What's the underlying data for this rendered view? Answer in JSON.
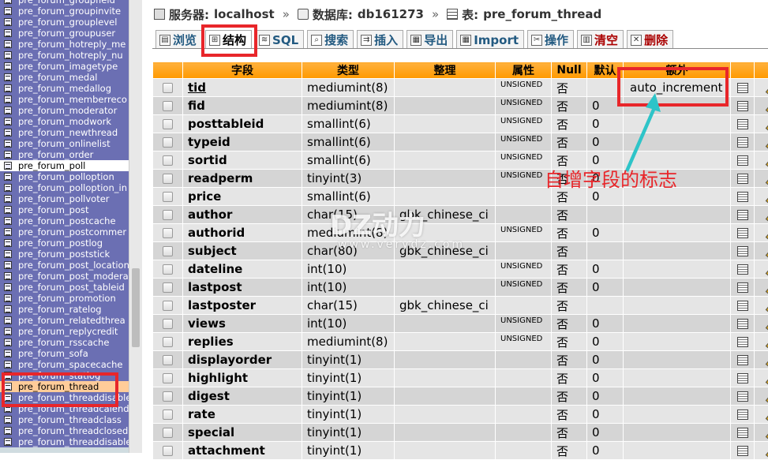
{
  "sidebar": {
    "items": [
      {
        "label": "pre_forum_groupfield",
        "state": "normal"
      },
      {
        "label": "pre_forum_groupinvite",
        "state": "normal"
      },
      {
        "label": "pre_forum_grouplevel",
        "state": "normal"
      },
      {
        "label": "pre_forum_groupuser",
        "state": "normal"
      },
      {
        "label": "pre_forum_hotreply_me",
        "state": "normal"
      },
      {
        "label": "pre_forum_hotreply_nu",
        "state": "normal"
      },
      {
        "label": "pre_forum_imagetype",
        "state": "normal"
      },
      {
        "label": "pre_forum_medal",
        "state": "normal"
      },
      {
        "label": "pre_forum_medallog",
        "state": "normal"
      },
      {
        "label": "pre_forum_memberreco",
        "state": "normal"
      },
      {
        "label": "pre_forum_moderator",
        "state": "normal"
      },
      {
        "label": "pre_forum_modwork",
        "state": "normal"
      },
      {
        "label": "pre_forum_newthread",
        "state": "normal"
      },
      {
        "label": "pre_forum_onlinelist",
        "state": "normal"
      },
      {
        "label": "pre_forum_order",
        "state": "normal"
      },
      {
        "label": "pre_forum_poll",
        "state": "plain"
      },
      {
        "label": "pre_forum_polloption",
        "state": "normal"
      },
      {
        "label": "pre_forum_polloption_in",
        "state": "normal"
      },
      {
        "label": "pre_forum_pollvoter",
        "state": "normal"
      },
      {
        "label": "pre_forum_post",
        "state": "normal"
      },
      {
        "label": "pre_forum_postcache",
        "state": "normal"
      },
      {
        "label": "pre_forum_postcommer",
        "state": "normal"
      },
      {
        "label": "pre_forum_postlog",
        "state": "normal"
      },
      {
        "label": "pre_forum_poststick",
        "state": "normal"
      },
      {
        "label": "pre_forum_post_location",
        "state": "normal"
      },
      {
        "label": "pre_forum_post_modera",
        "state": "normal"
      },
      {
        "label": "pre_forum_post_tableid",
        "state": "normal"
      },
      {
        "label": "pre_forum_promotion",
        "state": "normal"
      },
      {
        "label": "pre_forum_ratelog",
        "state": "normal"
      },
      {
        "label": "pre_forum_relatedthrea",
        "state": "normal"
      },
      {
        "label": "pre_forum_replycredit",
        "state": "normal"
      },
      {
        "label": "pre_forum_rsscache",
        "state": "normal"
      },
      {
        "label": "pre_forum_sofa",
        "state": "normal"
      },
      {
        "label": "pre_forum_spacecache",
        "state": "normal"
      },
      {
        "label": "pre_forum_statlog",
        "state": "normal"
      },
      {
        "label": "pre_forum_thread",
        "state": "highlight"
      },
      {
        "label": "pre_forum_threaddisablepos",
        "state": "normal"
      },
      {
        "label": "pre_forum_threadcalendar",
        "state": "normal"
      },
      {
        "label": "pre_forum_threadclass",
        "state": "normal"
      },
      {
        "label": "pre_forum_threadclosed",
        "state": "normal"
      },
      {
        "label": "pre_forum_threaddisable",
        "state": "normal"
      }
    ]
  },
  "breadcrumb": {
    "server_label": "服务器:",
    "server": "localhost",
    "db_label": "数据库:",
    "db": "db161273",
    "table_label": "表:",
    "table": "pre_forum_thread"
  },
  "tabs": [
    {
      "label": "浏览",
      "icon": "browse-icon",
      "glyph": "▤"
    },
    {
      "label": "结构",
      "icon": "structure-icon",
      "glyph": "⊞",
      "active": true
    },
    {
      "label": "SQL",
      "icon": "sql-icon",
      "glyph": "≋"
    },
    {
      "label": "搜索",
      "icon": "search-icon",
      "glyph": "⌕"
    },
    {
      "label": "插入",
      "icon": "insert-icon",
      "glyph": "⇉"
    },
    {
      "label": "导出",
      "icon": "export-icon",
      "glyph": "▦"
    },
    {
      "label": "Import",
      "icon": "import-icon",
      "glyph": "▦"
    },
    {
      "label": "操作",
      "icon": "operations-icon",
      "glyph": "✂"
    },
    {
      "label": "清空",
      "icon": "empty-icon",
      "glyph": "▥",
      "danger": true
    },
    {
      "label": "删除",
      "icon": "drop-icon",
      "glyph": "✕",
      "danger": true
    }
  ],
  "table": {
    "headers": [
      "",
      "字段",
      "类型",
      "整理",
      "属性",
      "Null",
      "默认",
      "额外",
      "",
      ""
    ],
    "rows": [
      {
        "field": "tid",
        "type": "mediumint(8)",
        "collation": "",
        "attr": "UNSIGNED",
        "null": "否",
        "default": "",
        "extra": "auto_increment"
      },
      {
        "field": "fid",
        "type": "mediumint(8)",
        "collation": "",
        "attr": "UNSIGNED",
        "null": "否",
        "default": "0",
        "extra": ""
      },
      {
        "field": "posttableid",
        "type": "smallint(6)",
        "collation": "",
        "attr": "UNSIGNED",
        "null": "否",
        "default": "0",
        "extra": ""
      },
      {
        "field": "typeid",
        "type": "smallint(6)",
        "collation": "",
        "attr": "UNSIGNED",
        "null": "否",
        "default": "0",
        "extra": ""
      },
      {
        "field": "sortid",
        "type": "smallint(6)",
        "collation": "",
        "attr": "UNSIGNED",
        "null": "否",
        "default": "0",
        "extra": ""
      },
      {
        "field": "readperm",
        "type": "tinyint(3)",
        "collation": "",
        "attr": "UNSIGNED",
        "null": "否",
        "default": "0",
        "extra": ""
      },
      {
        "field": "price",
        "type": "smallint(6)",
        "collation": "",
        "attr": "",
        "null": "否",
        "default": "0",
        "extra": ""
      },
      {
        "field": "author",
        "type": "char(15)",
        "collation": "gbk_chinese_ci",
        "attr": "",
        "null": "否",
        "default": "",
        "extra": ""
      },
      {
        "field": "authorid",
        "type": "mediumint(8)",
        "collation": "",
        "attr": "UNSIGNED",
        "null": "否",
        "default": "0",
        "extra": ""
      },
      {
        "field": "subject",
        "type": "char(80)",
        "collation": "gbk_chinese_ci",
        "attr": "",
        "null": "否",
        "default": "",
        "extra": ""
      },
      {
        "field": "dateline",
        "type": "int(10)",
        "collation": "",
        "attr": "UNSIGNED",
        "null": "否",
        "default": "0",
        "extra": ""
      },
      {
        "field": "lastpost",
        "type": "int(10)",
        "collation": "",
        "attr": "UNSIGNED",
        "null": "否",
        "default": "0",
        "extra": ""
      },
      {
        "field": "lastposter",
        "type": "char(15)",
        "collation": "gbk_chinese_ci",
        "attr": "",
        "null": "否",
        "default": "",
        "extra": ""
      },
      {
        "field": "views",
        "type": "int(10)",
        "collation": "",
        "attr": "UNSIGNED",
        "null": "否",
        "default": "0",
        "extra": ""
      },
      {
        "field": "replies",
        "type": "mediumint(8)",
        "collation": "",
        "attr": "UNSIGNED",
        "null": "否",
        "default": "0",
        "extra": ""
      },
      {
        "field": "displayorder",
        "type": "tinyint(1)",
        "collation": "",
        "attr": "",
        "null": "否",
        "default": "0",
        "extra": ""
      },
      {
        "field": "highlight",
        "type": "tinyint(1)",
        "collation": "",
        "attr": "",
        "null": "否",
        "default": "0",
        "extra": ""
      },
      {
        "field": "digest",
        "type": "tinyint(1)",
        "collation": "",
        "attr": "",
        "null": "否",
        "default": "0",
        "extra": ""
      },
      {
        "field": "rate",
        "type": "tinyint(1)",
        "collation": "",
        "attr": "",
        "null": "否",
        "default": "0",
        "extra": ""
      },
      {
        "field": "special",
        "type": "tinyint(1)",
        "collation": "",
        "attr": "",
        "null": "否",
        "default": "0",
        "extra": ""
      },
      {
        "field": "attachment",
        "type": "tinyint(1)",
        "collation": "",
        "attr": "",
        "null": "否",
        "default": "0",
        "extra": ""
      }
    ]
  },
  "annotation": {
    "note": "自增字段的标志",
    "color": "#e8262a",
    "arrow_color": "#2ec4c8"
  },
  "watermark": {
    "brand": "DZ动力",
    "url": "www.verydz.com"
  }
}
